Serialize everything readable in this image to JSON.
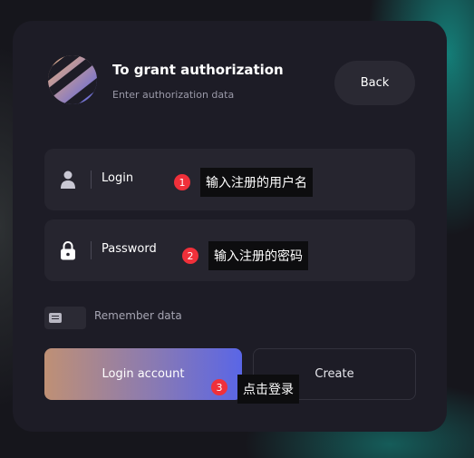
{
  "header": {
    "title": "To grant authorization",
    "subtitle": "Enter authorization data",
    "back_label": "Back",
    "logo_icon": "striped-globe-logo"
  },
  "form": {
    "login_label": "Login",
    "login_icon": "user-icon",
    "password_label": "Password",
    "password_icon": "lock-icon",
    "remember_label": "Remember data",
    "remember_icon": "toggle-icon"
  },
  "actions": {
    "login_label": "Login account",
    "create_label": "Create"
  },
  "annotations": [
    {
      "number": "1",
      "text": "输入注册的用户名"
    },
    {
      "number": "2",
      "text": "输入注册的密码"
    },
    {
      "number": "3",
      "text": "点击登录"
    }
  ],
  "colors": {
    "background": "#16161c",
    "card": "#1d1c26",
    "field": "#26252f",
    "accent_start": "#bf9075",
    "accent_end": "#5a66e6",
    "annotation_dot": "#f0303a"
  }
}
